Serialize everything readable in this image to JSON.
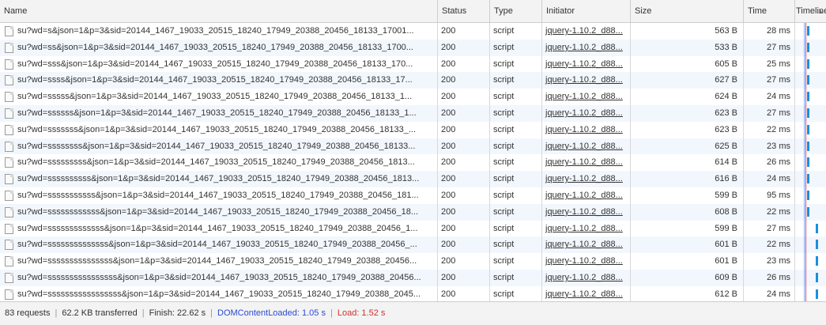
{
  "columns": {
    "name": "Name",
    "status": "Status",
    "type": "Type",
    "initiator": "Initiator",
    "size": "Size",
    "time": "Time",
    "timeline": "Timeline"
  },
  "rows": [
    {
      "name": "su?wd=s&json=1&p=3&sid=20144_1467_19033_20515_18240_17949_20388_20456_18133_17001...",
      "status": "200",
      "type": "script",
      "initiator": "jquery-1.10.2_d88...",
      "size": "563 B",
      "time": "28 ms",
      "timeline_offset": 0.0
    },
    {
      "name": "su?wd=ss&json=1&p=3&sid=20144_1467_19033_20515_18240_17949_20388_20456_18133_1700...",
      "status": "200",
      "type": "script",
      "initiator": "jquery-1.10.2_d88...",
      "size": "533 B",
      "time": "27 ms",
      "timeline_offset": 0.0
    },
    {
      "name": "su?wd=sss&json=1&p=3&sid=20144_1467_19033_20515_18240_17949_20388_20456_18133_170...",
      "status": "200",
      "type": "script",
      "initiator": "jquery-1.10.2_d88...",
      "size": "605 B",
      "time": "25 ms",
      "timeline_offset": 0.0
    },
    {
      "name": "su?wd=ssss&json=1&p=3&sid=20144_1467_19033_20515_18240_17949_20388_20456_18133_17...",
      "status": "200",
      "type": "script",
      "initiator": "jquery-1.10.2_d88...",
      "size": "627 B",
      "time": "27 ms",
      "timeline_offset": 0.0
    },
    {
      "name": "su?wd=sssss&json=1&p=3&sid=20144_1467_19033_20515_18240_17949_20388_20456_18133_1...",
      "status": "200",
      "type": "script",
      "initiator": "jquery-1.10.2_d88...",
      "size": "624 B",
      "time": "24 ms",
      "timeline_offset": 0.0
    },
    {
      "name": "su?wd=ssssss&json=1&p=3&sid=20144_1467_19033_20515_18240_17949_20388_20456_18133_1...",
      "status": "200",
      "type": "script",
      "initiator": "jquery-1.10.2_d88...",
      "size": "623 B",
      "time": "27 ms",
      "timeline_offset": 0.0
    },
    {
      "name": "su?wd=sssssss&json=1&p=3&sid=20144_1467_19033_20515_18240_17949_20388_20456_18133_...",
      "status": "200",
      "type": "script",
      "initiator": "jquery-1.10.2_d88...",
      "size": "623 B",
      "time": "22 ms",
      "timeline_offset": 0.0
    },
    {
      "name": "su?wd=ssssssss&json=1&p=3&sid=20144_1467_19033_20515_18240_17949_20388_20456_18133...",
      "status": "200",
      "type": "script",
      "initiator": "jquery-1.10.2_d88...",
      "size": "625 B",
      "time": "23 ms",
      "timeline_offset": 0.0
    },
    {
      "name": "su?wd=sssssssss&json=1&p=3&sid=20144_1467_19033_20515_18240_17949_20388_20456_1813...",
      "status": "200",
      "type": "script",
      "initiator": "jquery-1.10.2_d88...",
      "size": "614 B",
      "time": "26 ms",
      "timeline_offset": 0.0
    },
    {
      "name": "su?wd=ssssssssss&json=1&p=3&sid=20144_1467_19033_20515_18240_17949_20388_20456_1813...",
      "status": "200",
      "type": "script",
      "initiator": "jquery-1.10.2_d88...",
      "size": "616 B",
      "time": "24 ms",
      "timeline_offset": 0.0
    },
    {
      "name": "su?wd=sssssssssss&json=1&p=3&sid=20144_1467_19033_20515_18240_17949_20388_20456_181...",
      "status": "200",
      "type": "script",
      "initiator": "jquery-1.10.2_d88...",
      "size": "599 B",
      "time": "95 ms",
      "timeline_offset": 0.0
    },
    {
      "name": "su?wd=ssssssssssss&json=1&p=3&sid=20144_1467_19033_20515_18240_17949_20388_20456_18...",
      "status": "200",
      "type": "script",
      "initiator": "jquery-1.10.2_d88...",
      "size": "608 B",
      "time": "22 ms",
      "timeline_offset": 0.0
    },
    {
      "name": "su?wd=sssssssssssss&json=1&p=3&sid=20144_1467_19033_20515_18240_17949_20388_20456_1...",
      "status": "200",
      "type": "script",
      "initiator": "jquery-1.10.2_d88...",
      "size": "599 B",
      "time": "27 ms",
      "timeline_offset": 1.0
    },
    {
      "name": "su?wd=ssssssssssssss&json=1&p=3&sid=20144_1467_19033_20515_18240_17949_20388_20456_...",
      "status": "200",
      "type": "script",
      "initiator": "jquery-1.10.2_d88...",
      "size": "601 B",
      "time": "22 ms",
      "timeline_offset": 1.0
    },
    {
      "name": "su?wd=sssssssssssssss&json=1&p=3&sid=20144_1467_19033_20515_18240_17949_20388_20456...",
      "status": "200",
      "type": "script",
      "initiator": "jquery-1.10.2_d88...",
      "size": "601 B",
      "time": "23 ms",
      "timeline_offset": 1.0
    },
    {
      "name": "su?wd=ssssssssssssssss&json=1&p=3&sid=20144_1467_19033_20515_18240_17949_20388_20456...",
      "status": "200",
      "type": "script",
      "initiator": "jquery-1.10.2_d88...",
      "size": "609 B",
      "time": "26 ms",
      "timeline_offset": 1.0
    },
    {
      "name": "su?wd=sssssssssssssssss&json=1&p=3&sid=20144_1467_19033_20515_18240_17949_20388_2045...",
      "status": "200",
      "type": "script",
      "initiator": "jquery-1.10.2_d88...",
      "size": "612 B",
      "time": "24 ms",
      "timeline_offset": 1.0
    }
  ],
  "footer": {
    "requests": "83 requests",
    "transferred": "62.2 KB transferred",
    "finish": "Finish: 22.62 s",
    "dom_content_loaded": "DOMContentLoaded: 1.05 s",
    "load": "Load: 1.52 s"
  },
  "colors": {
    "timeline_bar": "#1a8fe0",
    "dom_content_loaded": "#2b4bd4",
    "load": "#d03030",
    "row_alt": "#f2f7fd"
  }
}
